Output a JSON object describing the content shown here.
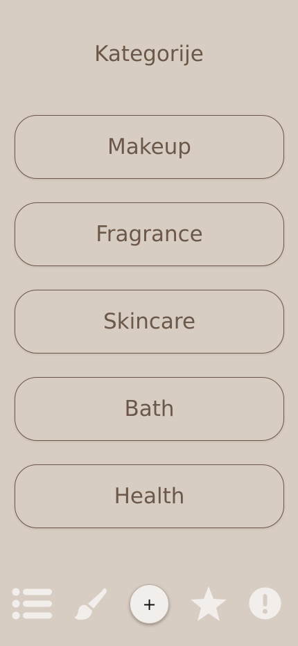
{
  "header": {
    "title": "Kategorije"
  },
  "categories": [
    {
      "label": "Makeup"
    },
    {
      "label": "Fragrance"
    },
    {
      "label": "Skincare"
    },
    {
      "label": "Bath"
    },
    {
      "label": "Health"
    }
  ],
  "bottom_nav": {
    "items": [
      {
        "icon": "list-icon"
      },
      {
        "icon": "paintbrush-icon"
      },
      {
        "icon": "plus-icon",
        "label": "+"
      },
      {
        "icon": "star-icon"
      },
      {
        "icon": "alert-icon"
      }
    ]
  },
  "colors": {
    "background": "#d8cdc3",
    "text": "#6b5848",
    "nav_icon": "#f2eeeb",
    "button_border": "#6b5848"
  }
}
